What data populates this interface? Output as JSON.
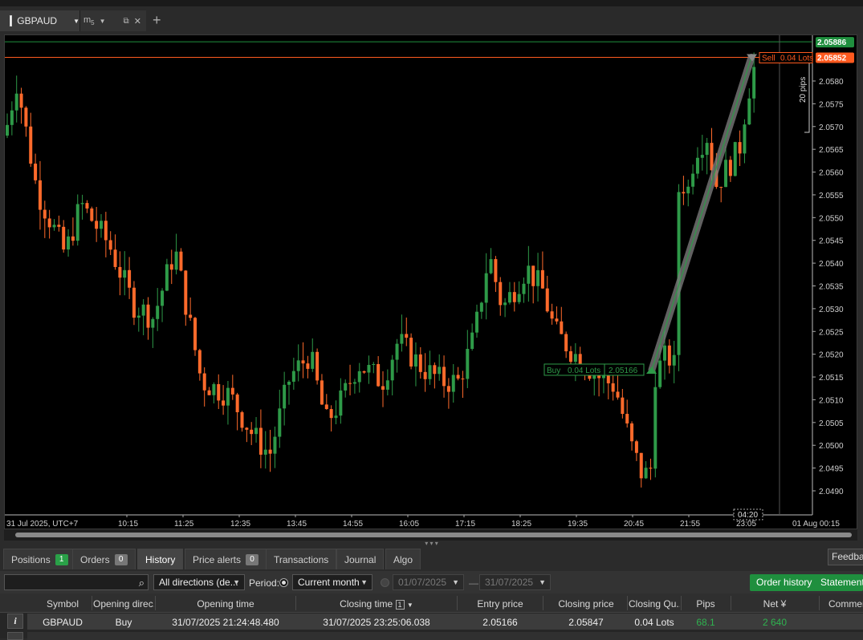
{
  "symbol_tab": {
    "symbol": "GBPAUD",
    "tf_label": "m",
    "tf_sub": "5"
  },
  "chart_data": {
    "type": "candlestick",
    "symbol": "GBPAUD",
    "y_ticks": [
      "2.0580",
      "2.0575",
      "2.0570",
      "2.0565",
      "2.0560",
      "2.0555",
      "2.0550",
      "2.0545",
      "2.0540",
      "2.0535",
      "2.0530",
      "2.0525",
      "2.0520",
      "2.0515",
      "2.0510",
      "2.0505",
      "2.0500",
      "2.0495",
      "2.0490"
    ],
    "x_ticks": [
      "31 Jul 2025, UTC+7",
      "10:15",
      "11:25",
      "12:35",
      "13:45",
      "14:55",
      "16:05",
      "17:15",
      "18:25",
      "19:35",
      "20:45",
      "21:55",
      "23:05",
      "01 Aug 00:15"
    ],
    "ylim": [
      2.04875,
      2.0596
    ],
    "ask_price": "2.05886",
    "bid_price": "2.05852",
    "cursor_time": "04:20",
    "buy_label": {
      "side": "Buy",
      "lots": "0.04 Lots",
      "price": "2.05166"
    },
    "sell_label": {
      "side": "Sell",
      "lots": "0.04 Lots"
    },
    "pips_label": "20 pips",
    "candles": []
  },
  "bottom_tabs": [
    {
      "label": "Positions",
      "count": "1"
    },
    {
      "label": "Orders",
      "count": "0"
    },
    {
      "label": "History"
    },
    {
      "label": "Price alerts",
      "count": "0"
    },
    {
      "label": "Transactions"
    },
    {
      "label": "Journal"
    },
    {
      "label": "Algo"
    }
  ],
  "feedback_label": "Feedbac",
  "filters": {
    "direction": "All directions (de...",
    "period_label": "Period:",
    "period": "Current month",
    "date_from": "01/07/2025",
    "date_sep": "—",
    "date_to": "31/07/2025",
    "order_history": "Order history",
    "statement": "Statement"
  },
  "table": {
    "headers": [
      "Symbol",
      "Opening direc..",
      "Opening time",
      "Closing time",
      "Entry price",
      "Closing price",
      "Closing Qu..",
      "Pips",
      "Net ¥",
      "Comment"
    ],
    "sort_badge": "1",
    "rows": [
      {
        "symbol": "GBPAUD",
        "direction": "Buy",
        "open_time": "31/07/2025 21:24:48.480",
        "close_time": "31/07/2025 23:25:06.038",
        "entry": "2.05166",
        "close": "2.05847",
        "qty": "0.04 Lots",
        "pips": "68.1",
        "net": "2 640"
      }
    ]
  },
  "colors": {
    "bull": "#2e9a48",
    "bear": "#ff6a2b",
    "ask": "#1f8f3e",
    "bid": "#ff5a1f"
  }
}
